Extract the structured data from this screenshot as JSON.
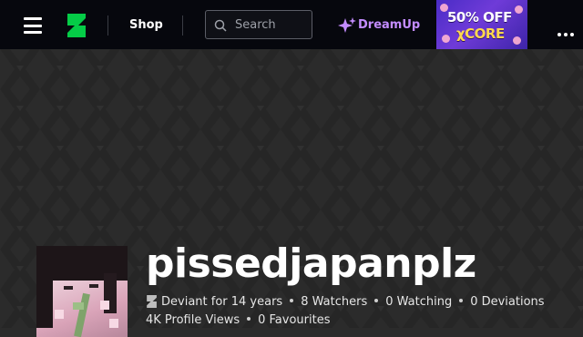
{
  "header": {
    "menu_icon": "hamburger-menu-icon",
    "logo_icon": "deviantart-logo-icon",
    "shop_label": "Shop",
    "search": {
      "placeholder": "Search",
      "icon": "search-icon"
    },
    "dreamup": {
      "label": "DreamUp",
      "icon": "sparkle-icon",
      "color": "#c38cff"
    },
    "promo": {
      "line1": "50% OFF",
      "line2": "χCORE"
    },
    "more_icon": "more-options-icon"
  },
  "profile": {
    "username": "pissedjapanplz",
    "deviant_icon": "deviantart-logo-icon",
    "deviant_for": "Deviant for 14 years",
    "watchers": "8 Watchers",
    "watching": "0 Watching",
    "deviations": "0 Deviations",
    "profile_views": "4K Profile Views",
    "favourites": "0 Favourites"
  },
  "colors": {
    "topbar": "#06070d",
    "accent_green": "#05cc47",
    "banner_bg": "#2b2b2b"
  }
}
